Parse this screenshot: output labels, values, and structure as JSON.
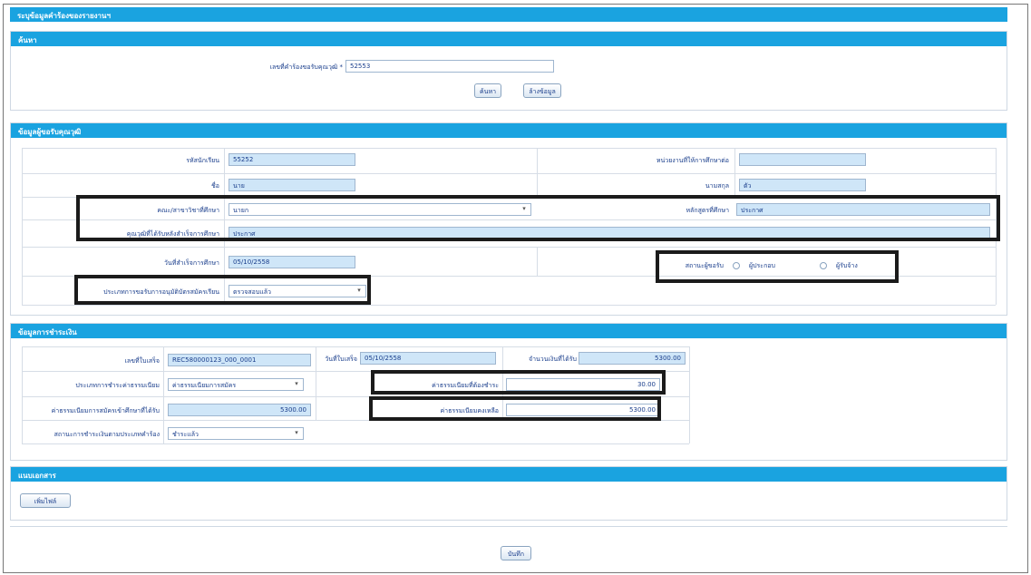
{
  "window": {
    "title": "ระบุข้อมูลคำร้องของรายงานฯ"
  },
  "search_section": {
    "header": "ค้นหา",
    "doc_label": "เลขที่คำร้องขอรับคุณวุฒิ *",
    "doc_value": "52553",
    "search_button": "ค้นหา",
    "clear_button": "ล้างข้อมูล"
  },
  "applicant_section": {
    "header": "ข้อมูลผู้ขอรับคุณวุฒิ",
    "student_id_label": "รหัสนักเรียน",
    "student_id_value": "55252",
    "right_label_1": "หน่วยงานที่ให้การศึกษาต่อ",
    "right_value_1": "",
    "name_label": "ชื่อ",
    "name_value": "นาย",
    "surname_label": "นามสกุล",
    "surname_value": "ตัว",
    "faculty_label": "คณะ/สาขาวิชาที่ศึกษา",
    "faculty_value": "นายก",
    "program_label": "หลักสูตรที่ศึกษา",
    "program_value": "ประกาศ",
    "degree_label": "คุณวุฒิที่ได้รับหลังสำเร็จการศึกษา",
    "degree_value": "ประกาศ",
    "date_label": "วันที่สำเร็จการศึกษา",
    "date_value": "05/10/2558",
    "status_label": "สถานะผู้ขอรับ",
    "status_option_1": "ผู้ประกอบ",
    "status_option_2": "ผู้รับจ้าง",
    "approval_label": "ประเภทการขอรับการอนุมัติบัตรสมัครเรียน",
    "approval_value": "ตรวจสอบแล้ว"
  },
  "fee_section": {
    "header": "ข้อมูลการชำระเงิน",
    "receipt_no_label": "เลขที่ใบเสร็จ",
    "receipt_no_value": "REC580000123_000_0001",
    "receipt_date_label": "วันที่ใบเสร็จ",
    "receipt_date_value": "05/10/2558",
    "total_label": "จำนวนเงินที่ได้รับ",
    "total_value": "5300.00",
    "fee_type_label": "ประเภทการชำระค่าธรรมเนียม",
    "fee_type_value": "ค่าธรรมเนียมการสมัคร",
    "fee_paid_label": "ค่าธรรมเนียมที่ต้องชำระ",
    "fee_paid_value": "30.00",
    "fee_amount_label": "ค่าธรรมเนียมการสมัครเข้าศึกษาที่ได้รับ",
    "fee_amount_value": "5300.00",
    "remaining_label": "ค่าธรรมเนียมคงเหลือ",
    "remaining_value": "5300.00",
    "payment_status_label": "สถานะการชำระเงินตามประเภทคำร้อง",
    "payment_status_value": "ชำระแล้ว"
  },
  "attachments_section": {
    "header": "แนบเอกสาร",
    "add_button": "เพิ่มไฟล์"
  },
  "footer": {
    "save_button": "บันทึก"
  }
}
